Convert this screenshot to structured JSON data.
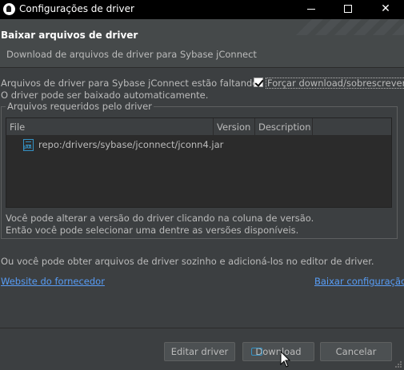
{
  "window": {
    "title": "Configurações de driver",
    "minimize_label": "",
    "maximize_label": "",
    "close_label": "✕"
  },
  "header": {
    "title": "Baixar arquivos de driver",
    "description": "Download de arquivos de driver para Sybase jConnect"
  },
  "status": {
    "line1": "Arquivos de driver para Sybase jConnect estão faltando.",
    "line2": "O driver pode ser baixado automaticamente."
  },
  "force_download": {
    "label": "Forçar download/sobrescrever",
    "checked": true
  },
  "files_group": {
    "title": "Arquivos requeridos pelo driver",
    "columns": [
      "File",
      "Version",
      "Description"
    ],
    "rows": [
      {
        "icon": "jar-file-icon",
        "file": "repo:/drivers/sybase/jconnect/jconn4.jar",
        "version": "",
        "description": ""
      }
    ],
    "hint_line1": "Você pode alterar a versão do driver clicando na coluna de versão.",
    "hint_line2": "Então você pode selecionar uma dentre as versões disponíveis."
  },
  "own_files_text": "Ou você pode obter arquivos de driver sozinho e adicioná-los no editor de driver.",
  "links": {
    "vendor": "Website do fornecedor",
    "config": "Baixar configuração"
  },
  "buttons": {
    "edit": "Editar driver",
    "download": "Download",
    "cancel": "Cancelar"
  },
  "colors": {
    "background": "#3c3f41",
    "link": "#589df6",
    "accent": "#3592c4"
  }
}
